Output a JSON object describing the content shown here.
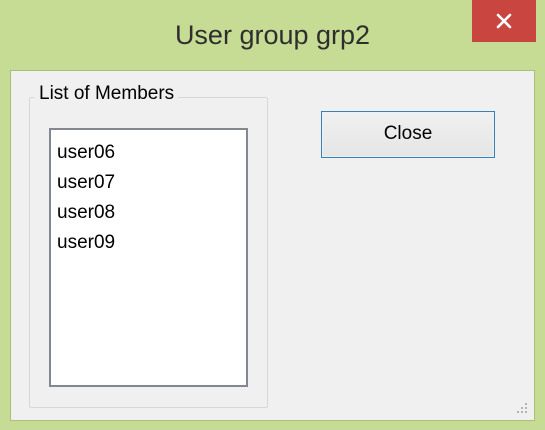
{
  "window": {
    "title": "User group grp2",
    "close_icon": "close-icon"
  },
  "group": {
    "label": "List of Members"
  },
  "members": [
    "user06",
    "user07",
    "user08",
    "user09"
  ],
  "buttons": {
    "close_label": "Close"
  },
  "colors": {
    "frame": "#c6db94",
    "close_x": "#c8463f",
    "button_border": "#3c7fb1"
  }
}
